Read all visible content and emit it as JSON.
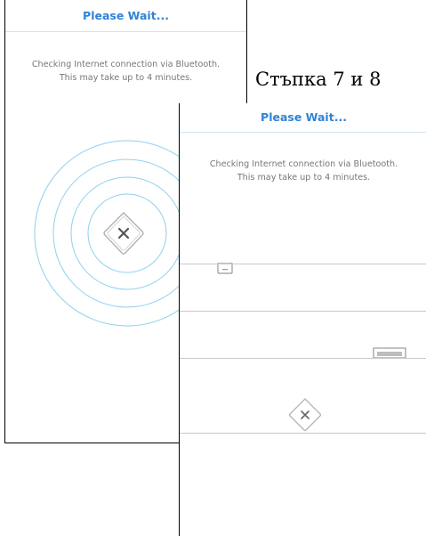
{
  "step_label": "Стъпка 7 и 8",
  "screens": [
    {
      "title": "Please Wait...",
      "message_line1": "Checking Internet connection via Bluetooth.",
      "message_line2": "This may take up to 4 minutes.",
      "icon": "router-x-icon"
    },
    {
      "title": "Please Wait...",
      "message_line1": "Checking Internet connection via Bluetooth.",
      "message_line2": "This may take up to 4 minutes.",
      "icon": "router-x-icon"
    }
  ],
  "colors": {
    "title": "#2f83d6",
    "ring": "#8fd0ee",
    "message": "#777777"
  }
}
